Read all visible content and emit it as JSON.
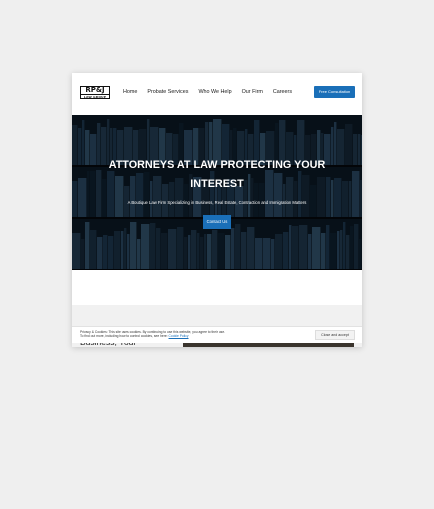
{
  "header": {
    "logo": {
      "main": "RP&J",
      "sub": "LAW GROUP"
    },
    "nav": [
      "Home",
      "Probate Services",
      "Who We Help",
      "Our Firm",
      "Careers"
    ],
    "cta_label": "Free Consultation"
  },
  "hero": {
    "title": "ATTORNEYS AT LAW PROTECTING YOUR INTEREST",
    "subtitle": "A Boutique Law Firm Specializing in Business, Real Estate, Contraction and Immigration Matters",
    "button_label": "Contact Us"
  },
  "next_section": {
    "partial_heading": "Business, Your"
  },
  "cookie_notice": {
    "line1": "Privacy & Cookies: This site uses cookies. By continuing to use this website, you agree to their use.",
    "line2": "To find out more, including how to control cookies, see here:",
    "link_label": "Cookie Policy",
    "button_label": "Close and accept"
  },
  "colors": {
    "accent": "#1a6fb8",
    "hero_bg": "#0c1a26",
    "page_bg": "#efefef"
  }
}
